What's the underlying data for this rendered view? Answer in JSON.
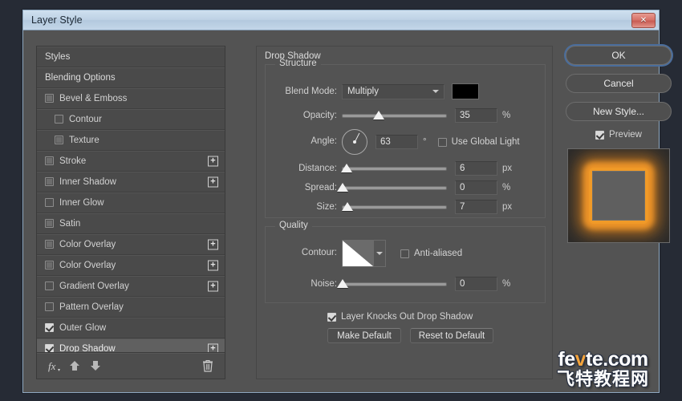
{
  "window": {
    "title": "Layer Style",
    "close_label": "✕"
  },
  "styles_panel": {
    "items": [
      {
        "label": "Styles",
        "type": "header",
        "checkbox": "none",
        "plus": false,
        "selected": false
      },
      {
        "label": "Blending Options",
        "type": "header",
        "checkbox": "none",
        "plus": false,
        "selected": false
      },
      {
        "label": "Bevel & Emboss",
        "type": "effect",
        "checkbox": "semi",
        "plus": false,
        "selected": false
      },
      {
        "label": "Contour",
        "type": "sub",
        "checkbox": "empty",
        "plus": false,
        "selected": false
      },
      {
        "label": "Texture",
        "type": "sub",
        "checkbox": "semi",
        "plus": false,
        "selected": false
      },
      {
        "label": "Stroke",
        "type": "effect",
        "checkbox": "semi",
        "plus": true,
        "selected": false
      },
      {
        "label": "Inner Shadow",
        "type": "effect",
        "checkbox": "semi",
        "plus": true,
        "selected": false
      },
      {
        "label": "Inner Glow",
        "type": "effect",
        "checkbox": "empty",
        "plus": false,
        "selected": false
      },
      {
        "label": "Satin",
        "type": "effect",
        "checkbox": "semi",
        "plus": false,
        "selected": false
      },
      {
        "label": "Color Overlay",
        "type": "effect",
        "checkbox": "semi",
        "plus": true,
        "selected": false
      },
      {
        "label": "Color Overlay",
        "type": "effect",
        "checkbox": "semi",
        "plus": true,
        "selected": false
      },
      {
        "label": "Gradient Overlay",
        "type": "effect",
        "checkbox": "empty",
        "plus": true,
        "selected": false
      },
      {
        "label": "Pattern Overlay",
        "type": "effect",
        "checkbox": "empty",
        "plus": false,
        "selected": false
      },
      {
        "label": "Outer Glow",
        "type": "effect",
        "checkbox": "checked",
        "plus": false,
        "selected": false
      },
      {
        "label": "Drop Shadow",
        "type": "effect",
        "checkbox": "checked",
        "plus": true,
        "selected": true
      }
    ],
    "toolbar": {
      "fx_icon": "fx-icon",
      "up_icon": "arrow-up-icon",
      "down_icon": "arrow-down-icon",
      "trash_icon": "trash-icon"
    }
  },
  "effect": {
    "title": "Drop Shadow",
    "structure": {
      "group_label": "Structure",
      "blend_mode_label": "Blend Mode:",
      "blend_mode_value": "Multiply",
      "color_swatch": "#000000",
      "opacity_label": "Opacity:",
      "opacity_value": "35",
      "opacity_unit": "%",
      "angle_label": "Angle:",
      "angle_value": "63",
      "angle_unit": "°",
      "use_global_light_label": "Use Global Light",
      "use_global_light_checked": false,
      "distance_label": "Distance:",
      "distance_value": "6",
      "distance_unit": "px",
      "spread_label": "Spread:",
      "spread_value": "0",
      "spread_unit": "%",
      "size_label": "Size:",
      "size_value": "7",
      "size_unit": "px"
    },
    "quality": {
      "group_label": "Quality",
      "contour_label": "Contour:",
      "anti_aliased_label": "Anti-aliased",
      "anti_aliased_checked": false,
      "noise_label": "Noise:",
      "noise_value": "0",
      "noise_unit": "%"
    },
    "knockout_label": "Layer Knocks Out Drop Shadow",
    "knockout_checked": true,
    "make_default_label": "Make Default",
    "reset_default_label": "Reset to Default"
  },
  "actions": {
    "ok_label": "OK",
    "cancel_label": "Cancel",
    "new_style_label": "New Style...",
    "preview_label": "Preview",
    "preview_checked": true
  },
  "watermark": {
    "line1_a": "fe",
    "line1_b": "v",
    "line1_c": "te.com",
    "line2": "飞特教程网"
  }
}
